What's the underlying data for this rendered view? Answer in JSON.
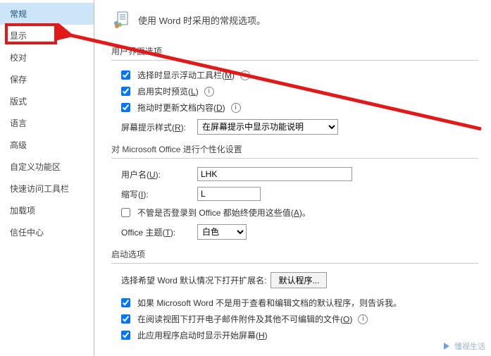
{
  "sidebar": {
    "items": [
      {
        "label": "常规"
      },
      {
        "label": "显示"
      },
      {
        "label": "校对"
      },
      {
        "label": "保存"
      },
      {
        "label": "版式"
      },
      {
        "label": "语言"
      },
      {
        "label": "高级"
      },
      {
        "label": "自定义功能区"
      },
      {
        "label": "快速访问工具栏"
      },
      {
        "label": "加载项"
      },
      {
        "label": "信任中心"
      }
    ]
  },
  "header": {
    "title": "使用 Word 时采用的常规选项。"
  },
  "sections": {
    "ui": {
      "title": "用户界面选项",
      "opts": [
        {
          "label": "选择时显示浮动工具栏(",
          "accel": "M",
          "tail": ")"
        },
        {
          "label": "启用实时预览(",
          "accel": "L",
          "tail": ")"
        },
        {
          "label": "拖动时更新文档内容(",
          "accel": "D",
          "tail": ")"
        }
      ],
      "tipStyle": {
        "label": "屏幕提示样式(",
        "accel": "R",
        "tail": "):",
        "value": "在屏幕提示中显示功能说明"
      }
    },
    "personalize": {
      "title": "对 Microsoft Office 进行个性化设置",
      "username": {
        "label": "用户名(",
        "accel": "U",
        "tail": "):",
        "value": "LHK"
      },
      "initials": {
        "label": "缩写(",
        "accel": "I",
        "tail": "):",
        "value": "L"
      },
      "alwaysUse": {
        "label": "不管是否登录到 Office 都始终使用这些值(",
        "accel": "A",
        "tail": ")。"
      },
      "theme": {
        "label": "Office 主题(",
        "accel": "T",
        "tail": "):",
        "value": "白色"
      }
    },
    "startup": {
      "title": "启动选项",
      "extRow": {
        "label": "选择希望 Word 默认情况下打开扩展名:",
        "button": "默认程序..."
      },
      "opts": [
        {
          "label": "如果 Microsoft Word 不是用于查看和编辑文档的默认程序，则告诉我。"
        },
        {
          "label": "在阅读视图下打开电子邮件附件及其他不可编辑的文件(",
          "accel": "O",
          "tail": ")"
        },
        {
          "label": "此应用程序启动时显示开始屏幕(",
          "accel": "H",
          "tail": ")"
        }
      ]
    }
  },
  "watermark": "懂视生活"
}
